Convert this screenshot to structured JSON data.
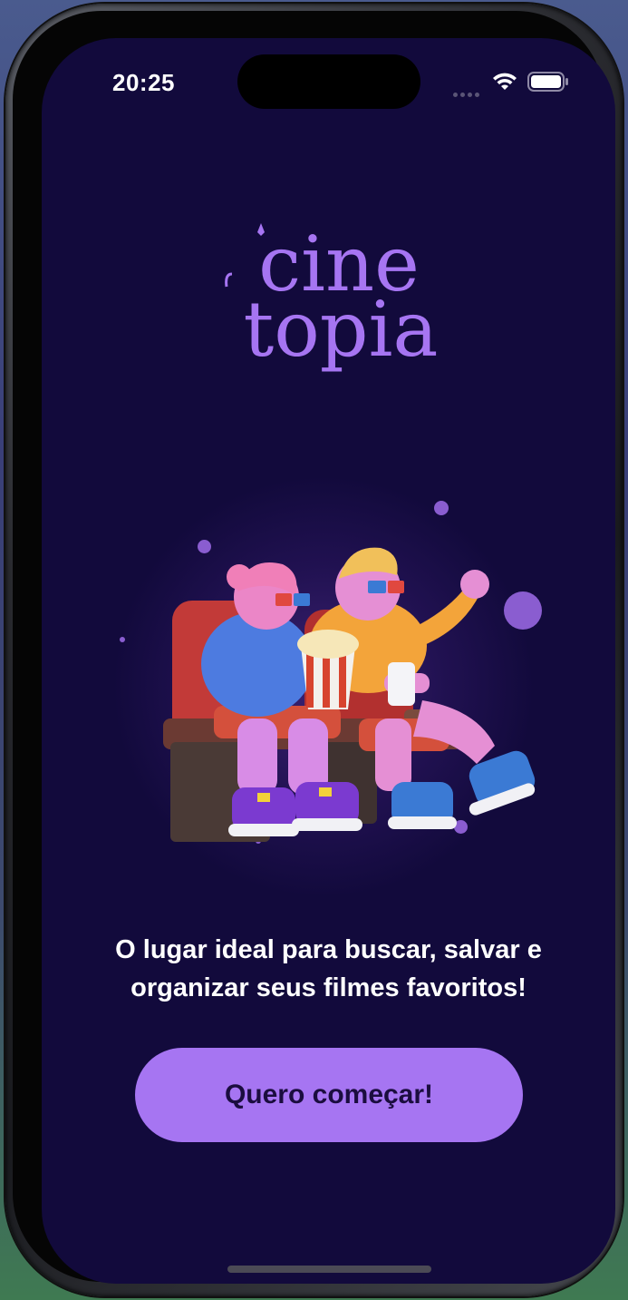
{
  "status_bar": {
    "time": "20:25"
  },
  "logo": {
    "line1": "cine",
    "line2": "topia",
    "color": "#a675f2"
  },
  "hero": {
    "illustration": "two-people-in-cinema-seats-with-3d-glasses-and-popcorn"
  },
  "tagline": {
    "line1": "O lugar ideal para buscar, salvar e",
    "line2": "organizar seus filmes favoritos!"
  },
  "cta": {
    "label": "Quero começar!",
    "color": "#a675f2"
  },
  "colors": {
    "background": "#120a3c",
    "accent": "#a675f2",
    "text": "#ffffff"
  }
}
